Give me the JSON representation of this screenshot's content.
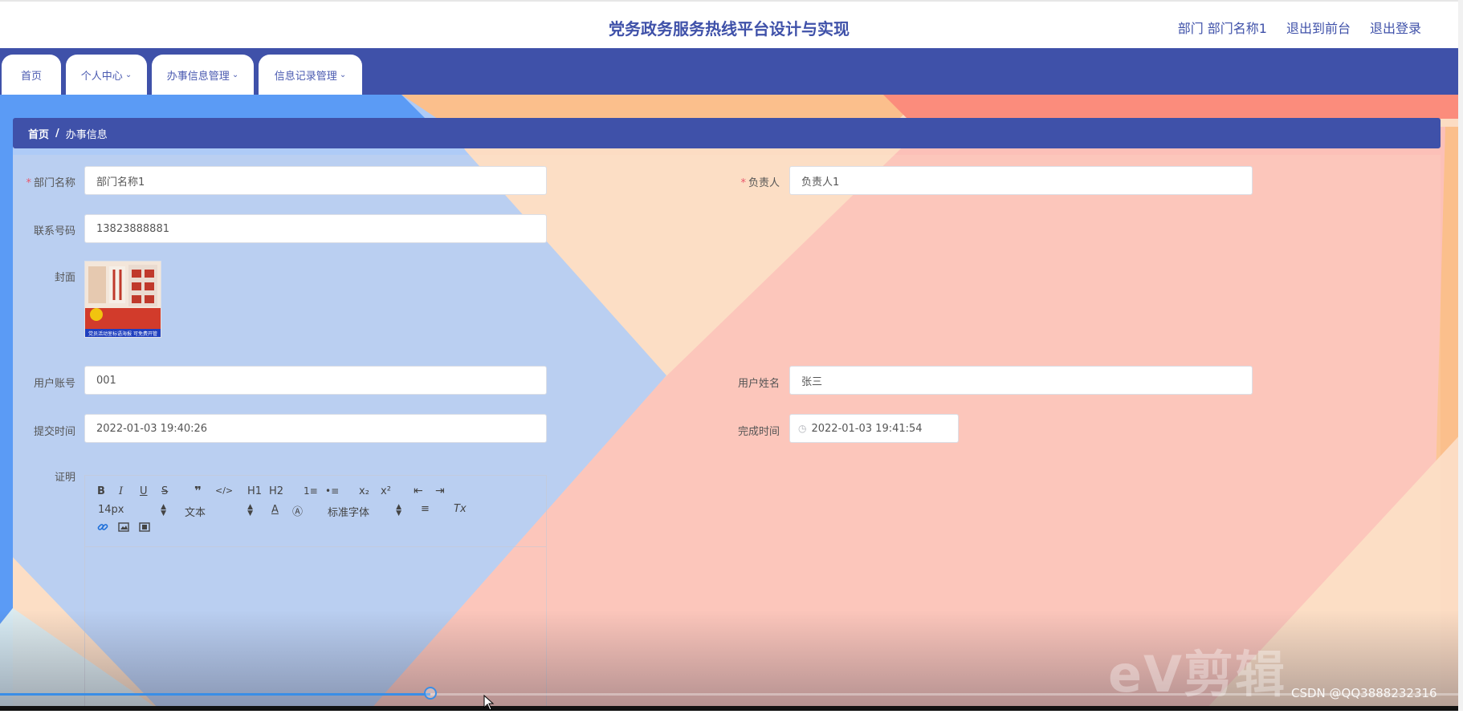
{
  "header": {
    "title": "党务政务服务热线平台设计与实现",
    "links": [
      "部门 部门名称1",
      "退出到前台",
      "退出登录"
    ]
  },
  "nav": {
    "tabs": [
      {
        "label": "首页",
        "has_menu": false
      },
      {
        "label": "个人中心",
        "has_menu": true
      },
      {
        "label": "办事信息管理",
        "has_menu": true
      },
      {
        "label": "信息记录管理",
        "has_menu": true
      }
    ]
  },
  "breadcrumb": {
    "home": "首页",
    "separator": "/",
    "current": "办事信息"
  },
  "form": {
    "dept_label": "部门名称",
    "dept_value": "部门名称1",
    "owner_label": "负责人",
    "owner_value": "负责人1",
    "phone_label": "联系号码",
    "phone_value": "13823888881",
    "cover_label": "封面",
    "cover_caption": "党员活动室标语海报 可免费开管",
    "account_label": "用户账号",
    "account_value": "001",
    "username_label": "用户姓名",
    "username_value": "张三",
    "submit_time_label": "提交时间",
    "submit_time_value": "2022-01-03 19:40:26",
    "finish_time_label": "完成时间",
    "finish_time_value": "2022-01-03 19:41:54",
    "proof_label": "证明",
    "required_mark": "*"
  },
  "editor": {
    "row1": [
      "B",
      "I",
      "U",
      "S",
      "❞",
      "</>",
      "H1",
      "H2",
      "1≡",
      "•≡",
      "x₂",
      "x²",
      "⇤",
      "⇥"
    ],
    "font_size": "14px",
    "block_type": "文本",
    "font_family": "标准字体",
    "buttons_row2": [
      "A",
      "Ⓐ",
      "≡",
      "Tx"
    ]
  },
  "overlay": {
    "watermark": "eV剪辑",
    "csdn": "CSDN @QQ3888232316",
    "progress_fraction": 0.294
  },
  "colors": {
    "primary": "#3f51a9",
    "bg_blue": "#aecbf7",
    "bg_blue_dark": "#5b9bf5",
    "bg_peach": "#fcdcc3",
    "bg_orange": "#fbbf8c",
    "bg_pink": "#fcc0b8",
    "bg_red": "#fb8c7c",
    "required": "#e9576b"
  }
}
